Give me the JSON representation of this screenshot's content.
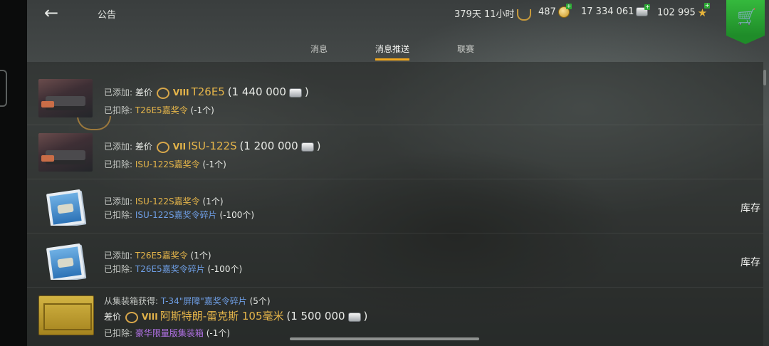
{
  "header": {
    "back_label": "←",
    "title": "公告",
    "premium": "379天 11小时",
    "gold": "487",
    "credits": "17 334 061",
    "free_xp": "102 995"
  },
  "tabs": [
    {
      "label": "消息",
      "active": false
    },
    {
      "label": "消息推送",
      "active": true
    },
    {
      "label": "联赛",
      "active": false
    }
  ],
  "rows": [
    {
      "line1": {
        "prefix": "已添加:",
        "diff": "差价",
        "tier": "VIII",
        "tank": "T26E5",
        "price_open": "(1 440 000",
        "price_close": ")"
      },
      "line2": {
        "prefix": "已扣除:",
        "item": "T26E5嘉奖令",
        "count": "(-1个)"
      }
    },
    {
      "line1": {
        "prefix": "已添加:",
        "diff": "差价",
        "tier": "VII",
        "tank": "ISU-122S",
        "price_open": "(1 200 000",
        "price_close": ")"
      },
      "line2": {
        "prefix": "已扣除:",
        "item": "ISU-122S嘉奖令",
        "count": "(-1个)"
      }
    },
    {
      "line1": {
        "prefix": "已添加:",
        "item": "ISU-122S嘉奖令",
        "count": "(1个)"
      },
      "line2": {
        "prefix": "已扣除:",
        "item": "ISU-122S嘉奖令碎片",
        "count": "(-100个)"
      },
      "action": "库存"
    },
    {
      "line1": {
        "prefix": "已添加:",
        "item": "T26E5嘉奖令",
        "count": "(1个)"
      },
      "line2": {
        "prefix": "已扣除:",
        "item": "T26E5嘉奖令碎片",
        "count": "(-100个)"
      },
      "action": "库存"
    },
    {
      "line1": {
        "prefix": "从集装箱获得:",
        "item": "T-34\"屏障\"嘉奖令碎片",
        "count": "(5个)"
      },
      "line2": {
        "diff": "差价",
        "tier": "VIII",
        "tank": "阿斯特朗-雷克斯 105毫米",
        "price_open": "(1 500 000",
        "price_close": ")"
      },
      "line3": {
        "prefix": "已扣除:",
        "item": "豪华限量版集装箱",
        "count": "(-1个)"
      }
    }
  ],
  "colors": {
    "accent": "#f2a81d",
    "gold_text": "#e5b54a",
    "blue_text": "#6f9fe6",
    "purple_text": "#b272e6",
    "shop_green": "#2ea836"
  }
}
